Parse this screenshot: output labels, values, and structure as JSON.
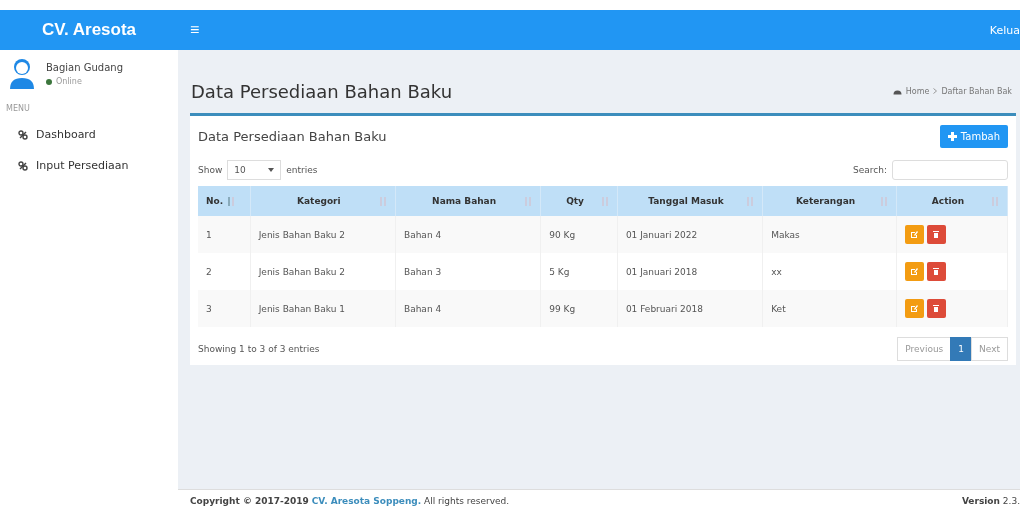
{
  "header": {
    "brand": "CV. Aresota",
    "menu_toggle": "≡",
    "logout": "Kelua"
  },
  "sidebar": {
    "user": {
      "name": "Bagian Gudang",
      "status": "Online"
    },
    "menu_label": "MENU",
    "items": [
      {
        "label": "Dashboard",
        "selected": false
      },
      {
        "label": "Input Persediaan",
        "selected": false
      }
    ]
  },
  "page": {
    "title": "Data Persediaan Bahan Baku",
    "breadcrumb": [
      "Home",
      "Daftar Bahan Bak"
    ]
  },
  "box": {
    "title": "Data Persediaan Bahan Baku",
    "add_button": "Tambah",
    "show_label": "Show",
    "page_size": "10",
    "entries_label": "entries",
    "search_label": "Search:",
    "table": {
      "columns": [
        "No.",
        "Kategori",
        "Nama Bahan",
        "Qty",
        "Tanggal Masuk",
        "Keterangan",
        "Action"
      ],
      "rows": [
        [
          "1",
          "Jenis Bahan Baku 2",
          "Bahan 4",
          "90 Kg",
          "01 Januari 2022",
          "Makas"
        ],
        [
          "2",
          "Jenis Bahan Baku 2",
          "Bahan 3",
          "5 Kg",
          "01 Januari 2018",
          "xx"
        ],
        [
          "3",
          "Jenis Bahan Baku 1",
          "Bahan 4",
          "99 Kg",
          "01 Februari 2018",
          "Ket"
        ]
      ]
    },
    "info": "Showing 1 to 3 of 3 entries",
    "pagination": [
      {
        "label": "Previous",
        "selected": false
      },
      {
        "label": "1",
        "selected": true
      },
      {
        "label": "Next",
        "selected": false
      }
    ]
  },
  "footer": {
    "copyright": "Copyright © 2017-2019",
    "link": "CV. Aresota Soppeng.",
    "rights": "All rights reserved.",
    "version": "**Version** 2.3."
  }
}
